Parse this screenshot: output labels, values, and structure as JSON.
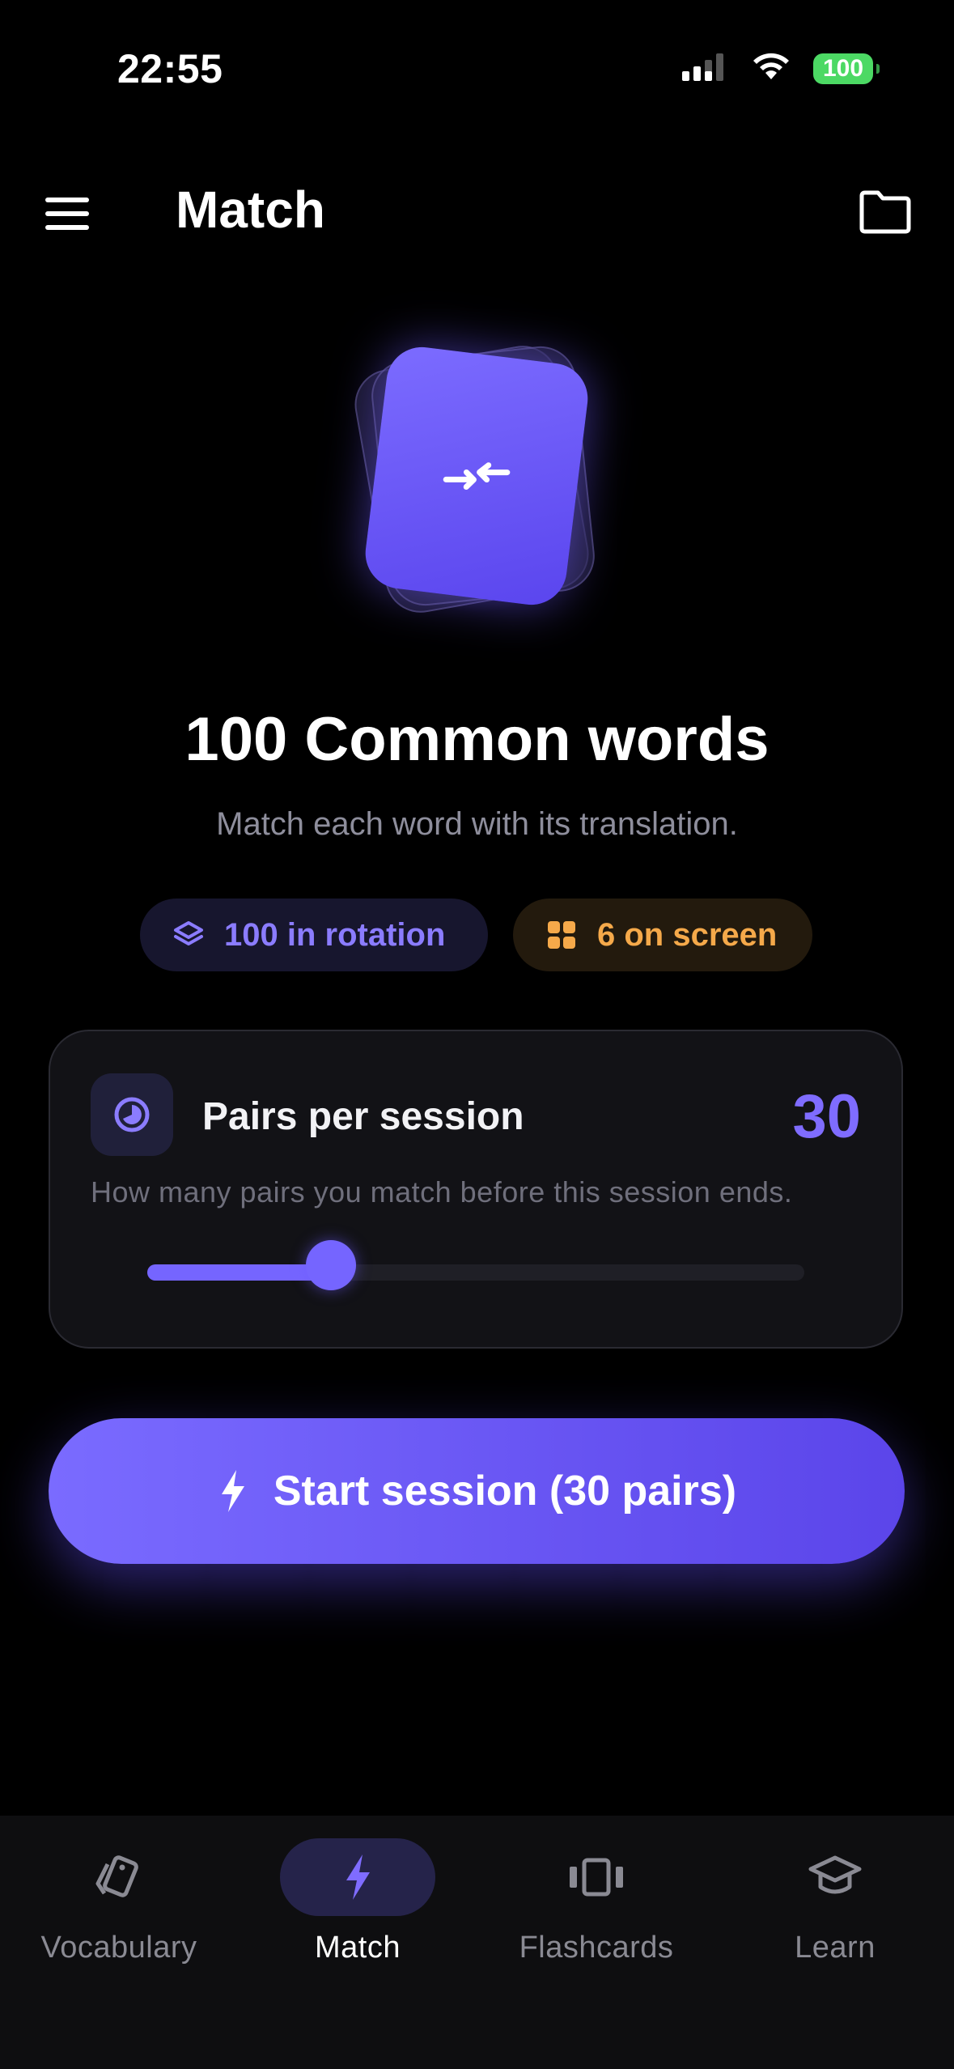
{
  "status_bar": {
    "time": "22:55",
    "battery": "100"
  },
  "header": {
    "title": "Match",
    "menu_icon": "hamburger-menu-icon",
    "folder_icon": "folder-icon"
  },
  "deck": {
    "title": "100 Common words",
    "subtitle": "Match each word with its translation.",
    "chips": {
      "rotation": "100 in rotation",
      "on_screen": "6 on screen"
    }
  },
  "settings": {
    "pairs_label": "Pairs per session",
    "pairs_value": "30",
    "pairs_description": "How many pairs you match before this session ends.",
    "slider_fraction": 0.28
  },
  "cta": {
    "label": "Start session (30 pairs)"
  },
  "tabs": [
    {
      "label": "Vocabulary",
      "icon": "cards-icon",
      "active": false
    },
    {
      "label": "Match",
      "icon": "bolt-icon",
      "active": true
    },
    {
      "label": "Flashcards",
      "icon": "flashcards-icon",
      "active": false
    },
    {
      "label": "Learn",
      "icon": "graduation-cap-icon",
      "active": false
    }
  ],
  "colors": {
    "accent": "#7565ff",
    "chip_orange": "#f5a94a",
    "battery": "#4cd964"
  }
}
